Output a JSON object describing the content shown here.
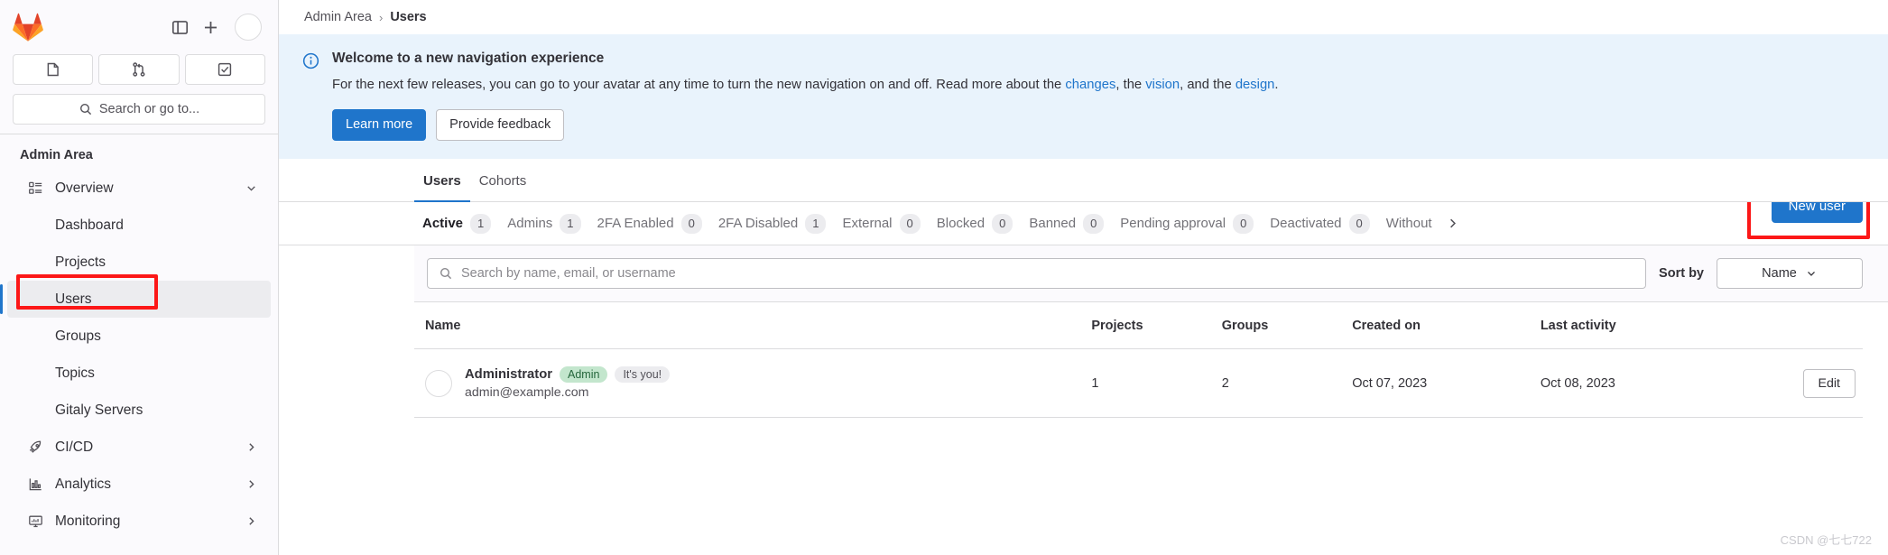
{
  "sidebar": {
    "logo_name": "gitlab-logo",
    "top_actions": [
      {
        "name": "toggle-sidebar-icon",
        "label": ""
      },
      {
        "name": "create-new-icon",
        "label": ""
      },
      {
        "name": "user-avatar",
        "label": ""
      }
    ],
    "quick_actions": [
      {
        "name": "issues-icon",
        "label": ""
      },
      {
        "name": "merge-requests-icon",
        "label": ""
      },
      {
        "name": "todos-icon",
        "label": ""
      }
    ],
    "search_placeholder": "Search or go to...",
    "section_title": "Admin Area",
    "items": [
      {
        "label": "Overview",
        "icon": "overview-icon",
        "level": "top",
        "expanded": true,
        "active": false
      },
      {
        "label": "Dashboard",
        "icon": "",
        "level": "sub",
        "active": false
      },
      {
        "label": "Projects",
        "icon": "",
        "level": "sub",
        "active": false
      },
      {
        "label": "Users",
        "icon": "",
        "level": "sub",
        "active": true
      },
      {
        "label": "Groups",
        "icon": "",
        "level": "sub",
        "active": false
      },
      {
        "label": "Topics",
        "icon": "",
        "level": "sub",
        "active": false
      },
      {
        "label": "Gitaly Servers",
        "icon": "",
        "level": "sub",
        "active": false
      },
      {
        "label": "CI/CD",
        "icon": "rocket-icon",
        "level": "top",
        "expanded": false,
        "active": false
      },
      {
        "label": "Analytics",
        "icon": "chart-icon",
        "level": "top",
        "expanded": false,
        "active": false
      },
      {
        "label": "Monitoring",
        "icon": "monitor-icon",
        "level": "top",
        "expanded": false,
        "active": false
      }
    ]
  },
  "breadcrumb": {
    "root": "Admin Area",
    "separator": "›",
    "current": "Users"
  },
  "banner": {
    "icon": "information-icon",
    "title": "Welcome to a new navigation experience",
    "text_part1": "For the next few releases, you can go to your avatar at any time to turn the new navigation on and off. Read more about the ",
    "link_changes": "changes",
    "text_part2": ", the ",
    "link_vision": "vision",
    "text_part3": ", and the ",
    "link_design": "design",
    "text_part4": ".",
    "primary_button": "Learn more",
    "secondary_button": "Provide feedback",
    "bg_color": "#e9f3fc",
    "accent_color": "#1f75cb"
  },
  "top_tabs": [
    {
      "label": "Users",
      "active": true
    },
    {
      "label": "Cohorts",
      "active": false
    }
  ],
  "filter_tabs": [
    {
      "label": "Active",
      "count": "1",
      "active": true
    },
    {
      "label": "Admins",
      "count": "1",
      "active": false
    },
    {
      "label": "2FA Enabled",
      "count": "0",
      "active": false
    },
    {
      "label": "2FA Disabled",
      "count": "1",
      "active": false
    },
    {
      "label": "External",
      "count": "0",
      "active": false
    },
    {
      "label": "Blocked",
      "count": "0",
      "active": false
    },
    {
      "label": "Banned",
      "count": "0",
      "active": false
    },
    {
      "label": "Pending approval",
      "count": "0",
      "active": false
    },
    {
      "label": "Deactivated",
      "count": "0",
      "active": false
    },
    {
      "label": "Without",
      "count": "",
      "active": false
    }
  ],
  "filter_overflow_icon": "chevron-right-icon",
  "new_user_button": "New user",
  "search": {
    "placeholder": "Search by name, email, or username",
    "value": "",
    "icon": "search-icon"
  },
  "sort": {
    "label": "Sort by",
    "selected": "Name",
    "icon": "chevron-down-icon"
  },
  "table": {
    "columns": [
      "Name",
      "Projects",
      "Groups",
      "Created on",
      "Last activity",
      ""
    ],
    "rows": [
      {
        "avatar": "user-avatar",
        "name": "Administrator",
        "badges": [
          {
            "text": "Admin",
            "style": "admin"
          },
          {
            "text": "It's you!",
            "style": "you"
          }
        ],
        "email": "admin@example.com",
        "projects": "1",
        "groups": "2",
        "created_on": "Oct 07, 2023",
        "last_activity": "Oct 08, 2023",
        "action_label": "Edit"
      }
    ]
  },
  "annotations": {
    "highlight_color": "#fc1717",
    "targets": [
      "sidebar-item-users",
      "new-user-button"
    ]
  },
  "watermark": "CSDN @七七722"
}
